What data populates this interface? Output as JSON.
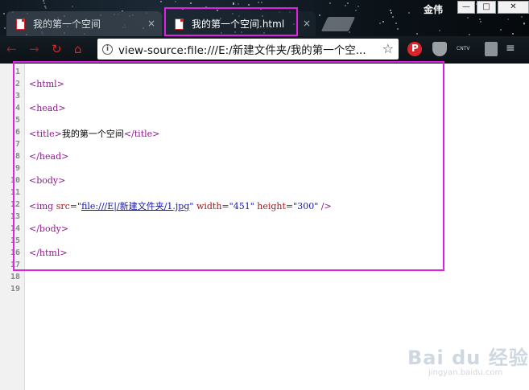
{
  "browser": {
    "username": "金伟",
    "window_buttons": {
      "minimize": "—",
      "maximize": "□",
      "close": "✕"
    },
    "tabs": [
      {
        "label": "我的第一个空间",
        "close": "×",
        "active": false
      },
      {
        "label": "我的第一个空间.html",
        "close": "×",
        "active": true
      }
    ],
    "nav": {
      "back": "←",
      "forward": "→",
      "reload": "↻",
      "home": "⌂"
    },
    "omnibox": {
      "info_icon": "i",
      "url": "view-source:file:///E:/新建文件夹/我的第一个空...",
      "star": "☆"
    },
    "extensions": [
      "P",
      "shield-icon",
      "CNTV",
      "lock-icon",
      "≡"
    ]
  },
  "source_view": {
    "line_numbers": [
      "1",
      "2",
      "3",
      "4",
      "5",
      "6",
      "7",
      "8",
      "9",
      "10",
      "11",
      "12",
      "13",
      "14",
      "15",
      "16",
      "17",
      "18",
      "19"
    ],
    "lines": [
      {
        "n": "2",
        "parts": [
          {
            "t": "tag",
            "v": "<html>"
          }
        ]
      },
      {
        "n": "4",
        "parts": [
          {
            "t": "tag",
            "v": "<head>"
          }
        ]
      },
      {
        "n": "6",
        "parts": [
          {
            "t": "tag",
            "v": "<title>"
          },
          {
            "t": "plain",
            "v": "我的第一个空间"
          },
          {
            "t": "tag",
            "v": "</title>"
          }
        ]
      },
      {
        "n": "8",
        "parts": [
          {
            "t": "tag",
            "v": "</head>"
          }
        ]
      },
      {
        "n": "10",
        "parts": [
          {
            "t": "tag",
            "v": "<body>"
          }
        ]
      },
      {
        "n": "12",
        "parts": [
          {
            "t": "tag",
            "v": "<img "
          },
          {
            "t": "attr",
            "v": "src="
          },
          {
            "t": "val",
            "v": "\""
          },
          {
            "t": "link",
            "v": "file:///E|/新建文件夹/1.jpg"
          },
          {
            "t": "val",
            "v": "\""
          },
          {
            "t": "attr",
            "v": " width="
          },
          {
            "t": "val",
            "v": "\"451\""
          },
          {
            "t": "attr",
            "v": " height="
          },
          {
            "t": "val",
            "v": "\"300\""
          },
          {
            "t": "tag",
            "v": " />"
          }
        ]
      },
      {
        "n": "14",
        "parts": [
          {
            "t": "tag",
            "v": "</body>"
          }
        ]
      },
      {
        "n": "16",
        "parts": [
          {
            "t": "tag",
            "v": "</html>"
          }
        ]
      }
    ]
  },
  "watermark": {
    "main": "Bai du 经验",
    "sub": "jingyan.baidu.com"
  },
  "colors": {
    "highlight": "#e021e4",
    "accent_red": "#d9262b"
  }
}
